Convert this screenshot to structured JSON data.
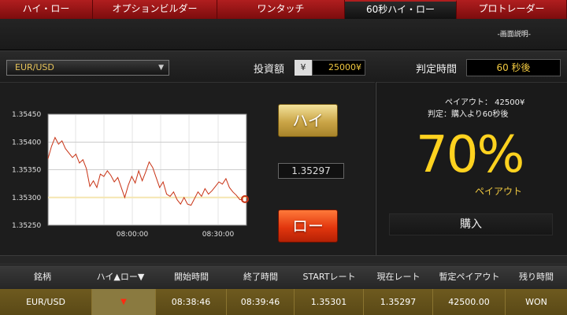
{
  "tabs": [
    {
      "label": "ハイ・ロー",
      "active": false
    },
    {
      "label": "オプションビルダー",
      "active": false
    },
    {
      "label": "ワンタッチ",
      "active": false
    },
    {
      "label": "60秒ハイ・ロー",
      "active": true
    },
    {
      "label": "プロトレーダー",
      "active": false
    }
  ],
  "header": {
    "help_link": "-画面説明-"
  },
  "controls": {
    "pair": "EUR/USD",
    "invest_label": "投資額",
    "currency_symbol": "¥",
    "invest_amount": "25000¥",
    "judge_label": "判定時間",
    "judge_time": "60 秒後"
  },
  "chart_data": {
    "type": "line",
    "yticks": [
      "1.35450",
      "1.35400",
      "1.35350",
      "1.35300",
      "1.35250"
    ],
    "ylim": [
      1.3525,
      1.3545
    ],
    "xticks": [
      "08:00:00",
      "08:30:00"
    ],
    "series": [
      {
        "values": [
          1.3537,
          1.35392,
          1.35408,
          1.35396,
          1.35402,
          1.35388,
          1.3538,
          1.35372,
          1.35378,
          1.35362,
          1.35368,
          1.35352,
          1.3532,
          1.3533,
          1.35318,
          1.35342,
          1.35338,
          1.35348,
          1.3534,
          1.35328,
          1.35336,
          1.35318,
          1.353,
          1.35322,
          1.35338,
          1.35326,
          1.35348,
          1.3533,
          1.35346,
          1.35364,
          1.35354,
          1.35336,
          1.35318,
          1.35328,
          1.35306,
          1.35302,
          1.3531,
          1.35296,
          1.35288,
          1.353,
          1.35288,
          1.35286,
          1.35298,
          1.3531,
          1.35302,
          1.35316,
          1.35306,
          1.35312,
          1.3532,
          1.35328,
          1.35324,
          1.35334,
          1.35318,
          1.3531,
          1.35304,
          1.35296,
          1.35297
        ]
      }
    ],
    "strike_value": 1.353,
    "colors": {
      "line": "#c83214",
      "strike": "#f5e6b0",
      "grid": "#555555",
      "background": "#ffffff"
    }
  },
  "trade": {
    "high_label": "ハイ",
    "low_label": "ロー",
    "current_rate": "1.35297"
  },
  "summary": {
    "payout_line": "ペイアウト： 42500¥",
    "judge_line": "判定：購入より60秒後",
    "percent": "70%",
    "percent_caption": "ペイアウト",
    "buy_label": "購入"
  },
  "table": {
    "headers": [
      "銘柄",
      "ハイ▲ロー▼",
      "開始時間",
      "終了時間",
      "STARTレート",
      "現在レート",
      "暫定ペイアウト",
      "残り時間"
    ],
    "row": {
      "pair": "EUR/USD",
      "direction": "▼",
      "start_time": "08:38:46",
      "end_time": "08:39:46",
      "start_rate": "1.35301",
      "current_rate": "1.35297",
      "payout": "42500.00",
      "remaining": "WON"
    }
  }
}
